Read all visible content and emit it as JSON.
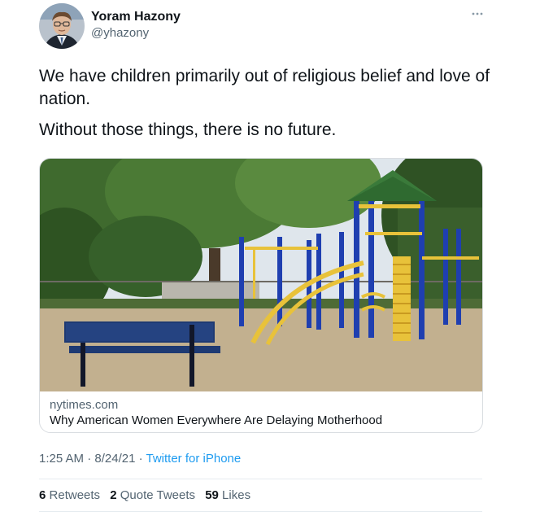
{
  "author": {
    "name": "Yoram Hazony",
    "handle": "@yhazony"
  },
  "more_icon": "more-horizontal-icon",
  "tweet": {
    "paragraphs": [
      "We have children primarily out of religious belief and love of nation.",
      "Without those things, there is no future."
    ]
  },
  "link_card": {
    "domain": "nytimes.com",
    "title": "Why American Women Everywhere Are Delaying Motherhood"
  },
  "meta": {
    "time": "1:25 AM",
    "sep1": " · ",
    "date": "8/24/21",
    "sep2": " · ",
    "source": "Twitter for iPhone"
  },
  "stats": {
    "retweets_count": "6",
    "retweets_label": "Retweets",
    "quotes_count": "2",
    "quotes_label": "Quote Tweets",
    "likes_count": "59",
    "likes_label": "Likes"
  },
  "colors": {
    "link_blue": "#1d9bf0",
    "secondary_text": "#536471",
    "primary_text": "#0f1419"
  }
}
